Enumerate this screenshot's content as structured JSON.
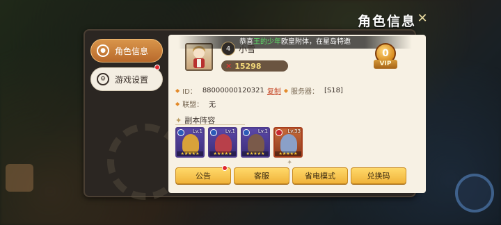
{
  "window": {
    "title": "角色信息",
    "close_icon": "close-x-icon"
  },
  "sidebar": {
    "items": [
      {
        "label": "角色信息",
        "icon": "person-icon",
        "active": true
      },
      {
        "label": "游戏设置",
        "icon": "gear-icon",
        "active": false,
        "has_notification": true
      }
    ]
  },
  "notice": {
    "prefix": "恭喜",
    "highlight": "王的少年",
    "suffix": "欧皇附体，在星岛特邀"
  },
  "profile": {
    "level": "4",
    "name": "小雪",
    "power": "15298",
    "power_icon": "crossed-swords-icon",
    "vip_level": "0",
    "vip_label": "VIP"
  },
  "info": {
    "id_label": "ID：",
    "id_value": "88000000120321",
    "copy_label": "复制",
    "server_label": "服务器：",
    "server_value": "[S18]",
    "alliance_label": "联盟：",
    "alliance_value": "无"
  },
  "lineup": {
    "title": "副本阵容",
    "heroes": [
      {
        "level": "Lv.1",
        "stars": "★★★★★",
        "color": "#d8a23a"
      },
      {
        "level": "Lv.1",
        "stars": "★★★★★",
        "color": "#b8404a"
      },
      {
        "level": "Lv.1",
        "stars": "★★★★★",
        "color": "#7a5a4a"
      },
      {
        "level": "Lv.33",
        "stars": "★★★★★",
        "color": "#8aa0c8"
      }
    ]
  },
  "buttons": [
    {
      "label": "公告",
      "has_notification": true
    },
    {
      "label": "客服",
      "has_notification": false
    },
    {
      "label": "省电模式",
      "has_notification": false
    },
    {
      "label": "兑换码",
      "has_notification": false
    }
  ],
  "colors": {
    "accent": "#f0b33a",
    "panel": "#f7f1e4",
    "highlight_name": "#5fe06a"
  }
}
